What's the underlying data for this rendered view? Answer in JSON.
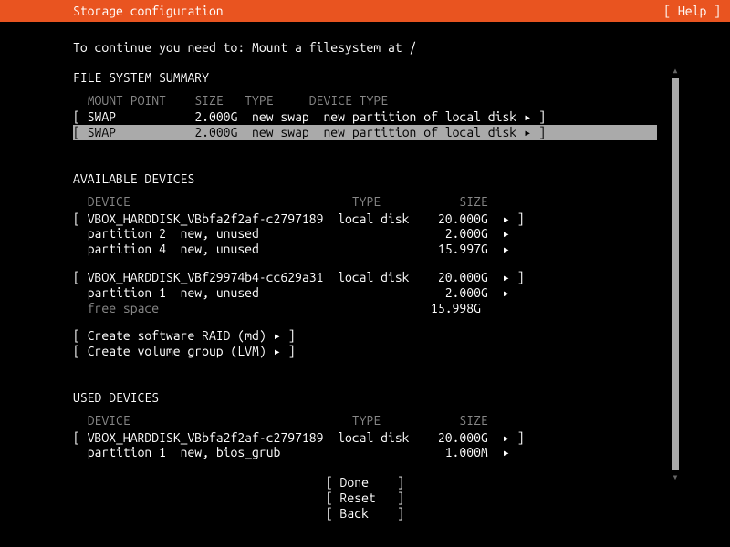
{
  "header": {
    "title": "Storage configuration",
    "help": "[ Help ]"
  },
  "instruction": "To continue you need to: Mount a filesystem at /",
  "fs_summary": {
    "title": "FILE SYSTEM SUMMARY",
    "cols": {
      "mount": "MOUNT POINT",
      "size": "SIZE",
      "type": "TYPE",
      "devtype": "DEVICE TYPE"
    },
    "rows": [
      {
        "mount": "SWAP",
        "size": "2.000G",
        "type": "new swap",
        "devtype": "new partition of local disk",
        "selected": false
      },
      {
        "mount": "SWAP",
        "size": "2.000G",
        "type": "new swap",
        "devtype": "new partition of local disk",
        "selected": true
      }
    ]
  },
  "available": {
    "title": "AVAILABLE DEVICES",
    "cols": {
      "device": "DEVICE",
      "type": "TYPE",
      "size": "SIZE"
    },
    "devices": [
      {
        "name": "VBOX_HARDDISK_VBbfa2f2af-c2797189",
        "type": "local disk",
        "size": "20.000G",
        "children": [
          {
            "name": "partition 2",
            "desc": "new, unused",
            "size": "2.000G"
          },
          {
            "name": "partition 4",
            "desc": "new, unused",
            "size": "15.997G"
          }
        ]
      },
      {
        "name": "VBOX_HARDDISK_VBf29974b4-cc629a31",
        "type": "local disk",
        "size": "20.000G",
        "children": [
          {
            "name": "partition 1",
            "desc": "new, unused",
            "size": "2.000G"
          },
          {
            "name": "free space",
            "desc": "",
            "size": "15.998G",
            "dim": true
          }
        ]
      }
    ],
    "actions": [
      "Create software RAID (md)",
      "Create volume group (LVM)"
    ]
  },
  "used": {
    "title": "USED DEVICES",
    "cols": {
      "device": "DEVICE",
      "type": "TYPE",
      "size": "SIZE"
    },
    "devices": [
      {
        "name": "VBOX_HARDDISK_VBbfa2f2af-c2797189",
        "type": "local disk",
        "size": "20.000G",
        "children": [
          {
            "name": "partition 1",
            "desc": "new, bios_grub",
            "size": "1.000M"
          }
        ]
      }
    ]
  },
  "buttons": {
    "done": "Done",
    "reset": "Reset",
    "back": "Back"
  },
  "glyph": {
    "arrow": "▸"
  }
}
